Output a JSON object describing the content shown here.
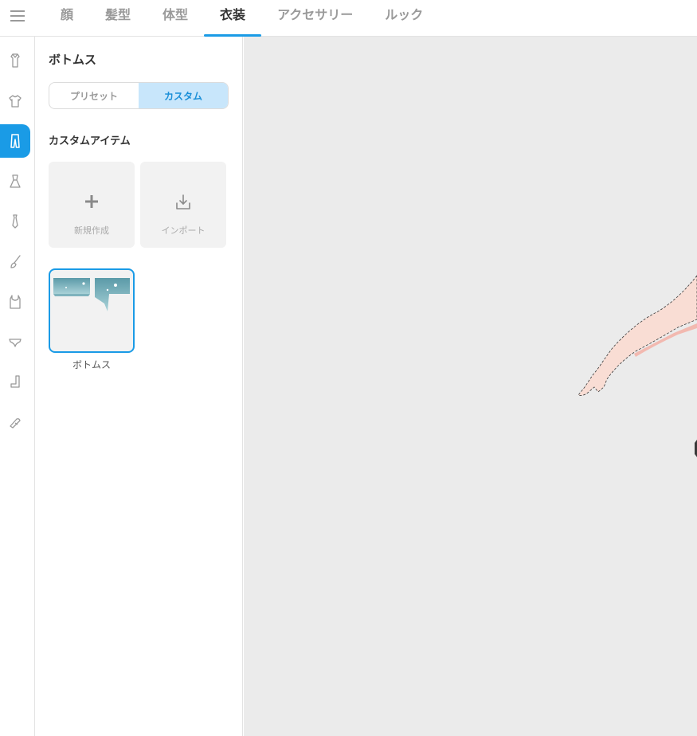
{
  "tabs": [
    {
      "label": "顔"
    },
    {
      "label": "髪型"
    },
    {
      "label": "体型"
    },
    {
      "label": "衣装"
    },
    {
      "label": "アクセサリー"
    },
    {
      "label": "ルック"
    }
  ],
  "active_tab": "衣装",
  "rail_icons": [
    "shirt-collar-icon",
    "tshirt-icon",
    "pants-icon",
    "dress-icon",
    "tie-icon",
    "brush-icon",
    "tank-top-icon",
    "underwear-icon",
    "sock-icon",
    "shoe-icon"
  ],
  "panel": {
    "title": "ボトムス",
    "segment": {
      "preset_label": "プリセット",
      "custom_label": "カスタム",
      "selected": "カスタム"
    },
    "custom_section_title": "カスタムアイテム",
    "new_label": "新規作成",
    "import_label": "インポート",
    "item": {
      "label": "ボトムス"
    }
  },
  "colors": {
    "accent": "#1a9be6",
    "viewport_bg": "#ebebeb"
  }
}
